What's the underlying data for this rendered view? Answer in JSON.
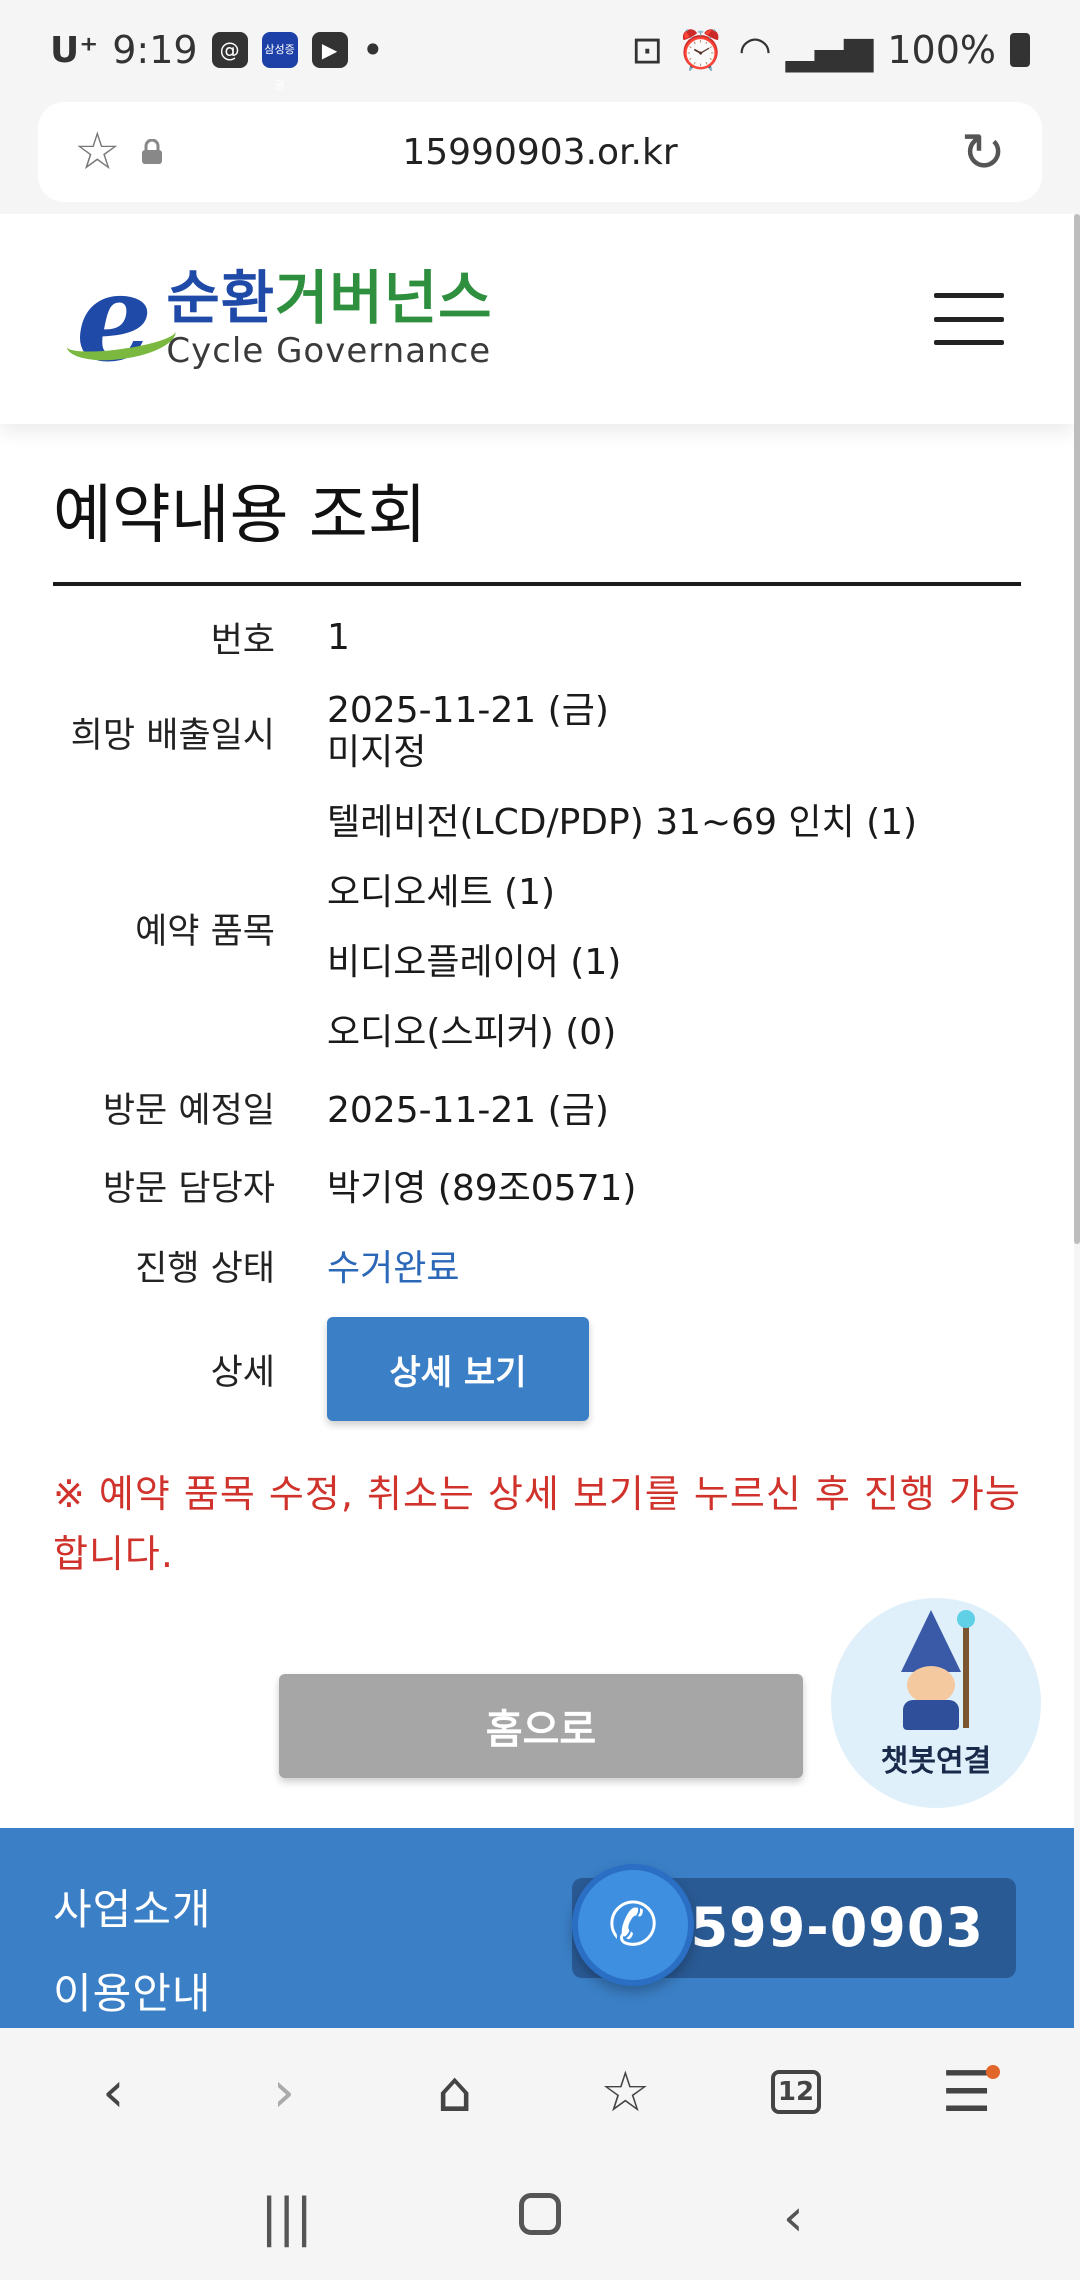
{
  "status_bar": {
    "carrier": "U⁺",
    "time": "9:19",
    "app_badge": "삼성증권",
    "dot": "•",
    "battery": "100%"
  },
  "browser": {
    "url": "15990903.or.kr"
  },
  "site": {
    "logo_ko_blue1": "순환",
    "logo_ko_green": "거버넌스",
    "logo_en": "Cycle Governance"
  },
  "page": {
    "title": "예약내용 조회",
    "rows": {
      "number_label": "번호",
      "number_value": "1",
      "date_label": "희망 배출일시",
      "date_value": "2025-11-21 (금)",
      "time_value": "미지정",
      "items_label": "예약 품목",
      "items": [
        "텔레비전(LCD/PDP) 31~69 인치 (1)",
        "오디오세트 (1)",
        "비디오플레이어 (1)",
        "오디오(스피커) (0)"
      ],
      "visit_label": "방문 예정일",
      "visit_value": "2025-11-21 (금)",
      "staff_label": "방문 담당자",
      "staff_value": "박기영 (89조0571)",
      "status_label": "진행 상태",
      "status_value": "수거완료",
      "detail_label": "상세",
      "detail_button": "상세 보기"
    },
    "notice": "※ 예약 품목 수정, 취소는 상세 보기를 누르신 후 진행 가능합니다.",
    "home_button": "홈으로",
    "chatbot_label": "챗봇연결"
  },
  "footer": {
    "links": [
      "사업소개",
      "이용안내"
    ],
    "phone": "1599-0903"
  },
  "bottom_nav": {
    "tabs_count": "12"
  },
  "colors": {
    "primary": "#3b7fc6",
    "status": "#2c68b8",
    "notice": "#d0322c",
    "home_button": "#a6a6a6"
  }
}
